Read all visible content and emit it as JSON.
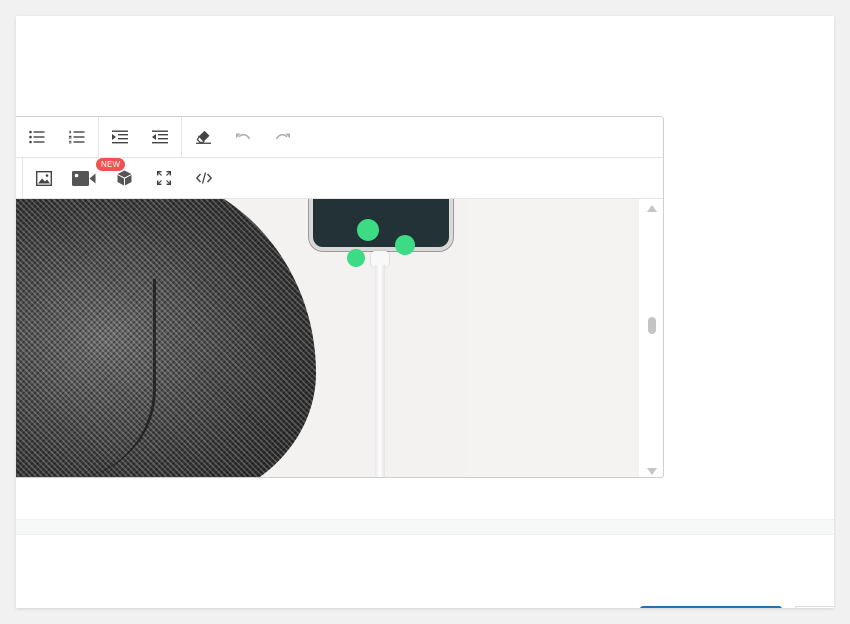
{
  "toolbar": {
    "row1": [
      {
        "name": "bulleted-list-button",
        "icon": "bulleted-list-icon"
      },
      {
        "name": "numbered-list-button",
        "icon": "numbered-list-icon"
      },
      {
        "name": "indent-button",
        "icon": "indent-icon"
      },
      {
        "name": "outdent-button",
        "icon": "outdent-icon"
      },
      {
        "name": "clear-formatting-button",
        "icon": "eraser-icon"
      },
      {
        "name": "undo-button",
        "icon": "undo-icon",
        "disabled": true
      },
      {
        "name": "redo-button",
        "icon": "redo-icon",
        "disabled": true
      }
    ],
    "row2": [
      {
        "name": "insert-image-button",
        "icon": "image-icon"
      },
      {
        "name": "insert-video-button",
        "icon": "video-camera-icon",
        "badge": "NEW"
      },
      {
        "name": "insert-3d-model-button",
        "icon": "cube-icon"
      },
      {
        "name": "fullscreen-button",
        "icon": "fullscreen-icon"
      },
      {
        "name": "source-code-button",
        "icon": "code-icon"
      }
    ],
    "badge_text": "NEW"
  },
  "colors": {
    "icon": "#444444",
    "icon_disabled": "#b0b0b0",
    "badge": "#ef5350",
    "accent": "#2271b1",
    "phone_dots": "#3ddc84"
  }
}
